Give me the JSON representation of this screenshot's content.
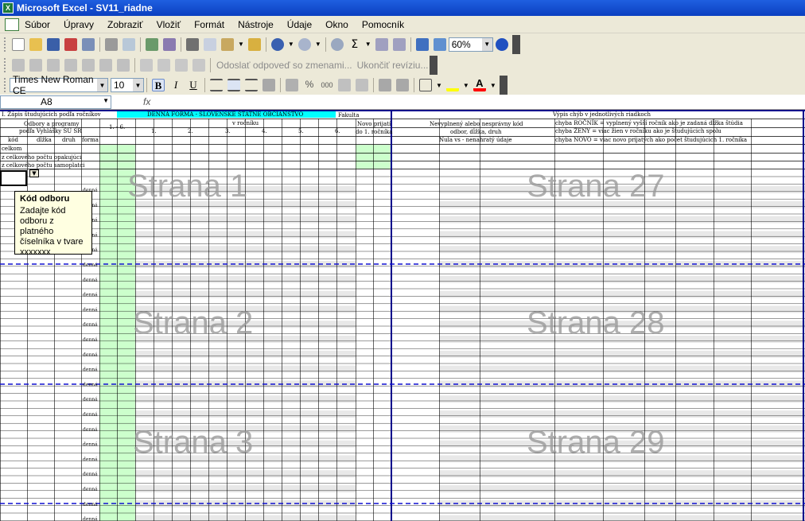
{
  "window": {
    "title": "Microsoft Excel - SV11_riadne"
  },
  "menu": [
    "Súbor",
    "Úpravy",
    "Zobraziť",
    "Vložiť",
    "Formát",
    "Nástroje",
    "Údaje",
    "Okno",
    "Pomocník"
  ],
  "toolbar": {
    "zoom": "60%",
    "reply_changes": "Odoslať odpoveď so zmenami...",
    "end_review": "Ukončiť revíziu...",
    "font_name": "Times New Roman CE",
    "font_size": "10"
  },
  "formula_bar": {
    "cell_ref": "A8",
    "fx": "fx"
  },
  "sheet": {
    "h_title": "I. Zápis študujúcich podľa ročníkov",
    "h_form": "DENNÁ FORMA - SLOVENSKÉ ŠTÁTNE OBČIANSTVO",
    "h_fakulta": "Fakulta",
    "h_errors": "Výpis chýb v jednotlivých riadkoch",
    "h_odbory": "Odbory a programy",
    "h_vyhlaska": "podľa Vyhlášky ŠÚ SR",
    "h_kod": "kód",
    "h_dlzka": "dĺžka",
    "h_druh": "druh",
    "h_forma": "forma",
    "h_1_6": "1. - 6.",
    "h_v_rocniku": "v ročníku",
    "h_years": [
      "1.",
      "2.",
      "3.",
      "4.",
      "5.",
      "6."
    ],
    "h_spolu": "spolu",
    "h_zeny": "ženy",
    "h_novo1": "Novo prijatí",
    "h_novo2": "do 1. ročníka",
    "h_nevyp1": "Nevyplnený alebo nesprávny kód",
    "h_nevyp2": "odbor, dĺžka, druh",
    "h_nevyp3": "Nula vs - nenahratý údaje",
    "err1": "chyba ROČNÍK = vyplnený vyšší ročník ako je zadaná dĺžka štúdia",
    "err2": "chyba ŽENY = viac žien v ročníku ako je študujúcich spolu",
    "err3": "chyba NOVO = viac novo prijatých ako počet študujúcich 1. ročníka",
    "r_celkom": "celkom",
    "r_opak": "z celkového počtu opakujúci",
    "r_samo": "z celkového počtu samoplatci",
    "denna": "denná",
    "watermarks": [
      "Strana 1",
      "Strana 27",
      "Strana 2",
      "Strana 28",
      "Strana 3",
      "Strana 29"
    ]
  },
  "tooltip": {
    "title": "Kód odboru",
    "text": "Zadajte kód odboru z platného číselníka v tvare xxxxxxx"
  }
}
